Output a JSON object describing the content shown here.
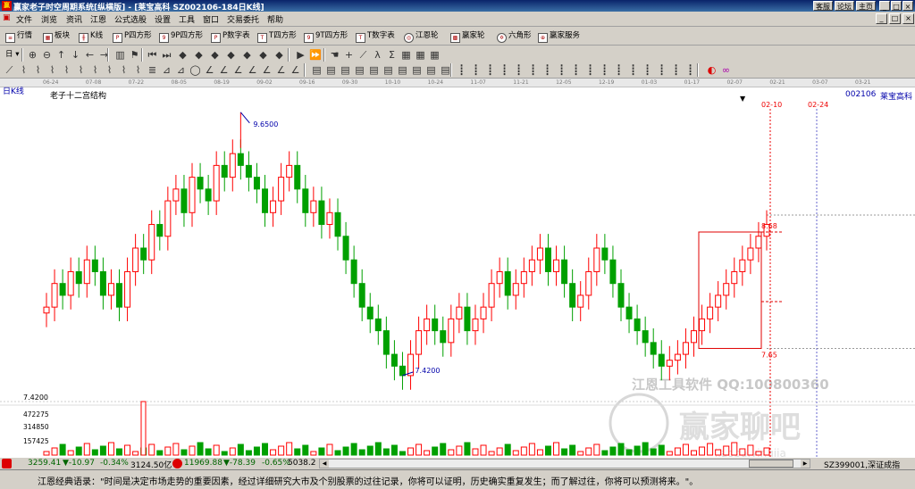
{
  "window": {
    "title": "赢家老子时空周期系统[纵横版] - [莱宝高科  SZ002106-184日K线]",
    "icon_text": "赢",
    "right_buttons": [
      "客服",
      "论坛",
      "主页"
    ],
    "controls": [
      "_",
      "□",
      "×"
    ]
  },
  "menu": {
    "items": [
      "文件",
      "浏览",
      "资讯",
      "江恩",
      "公式选股",
      "设置",
      "工具",
      "窗口",
      "交易委托",
      "帮助"
    ],
    "mdi_controls": [
      "_",
      "□",
      "×"
    ]
  },
  "toolbar1": {
    "items": [
      {
        "label": "行情",
        "icon": "quote-icon"
      },
      {
        "label": "板块",
        "icon": "sector-icon"
      },
      {
        "label": "K线",
        "icon": "kline-icon"
      },
      {
        "label": "P四方形",
        "icon": "p-square-icon"
      },
      {
        "label": "9P四方形",
        "icon": "9p-square-icon"
      },
      {
        "label": "P数字表",
        "icon": "p-table-icon"
      },
      {
        "label": "T四方形",
        "icon": "t-square-icon"
      },
      {
        "label": "9T四方形",
        "icon": "9t-square-icon"
      },
      {
        "label": "T数字表",
        "icon": "t-table-icon"
      },
      {
        "label": "江恩轮",
        "icon": "gann-wheel-icon"
      },
      {
        "label": "赢家轮",
        "icon": "winner-wheel-icon"
      },
      {
        "label": "六角形",
        "icon": "hexagon-icon"
      },
      {
        "label": "赢家服务",
        "icon": "service-icon"
      }
    ]
  },
  "toolbar2": {
    "period_label": "日"
  },
  "chart": {
    "period": "日K线",
    "name": "老子十二宫结构",
    "code": "002106",
    "stock": "莱宝高科",
    "date_ticks": [
      "06-24",
      "07-08",
      "07-22",
      "08-05",
      "08-19",
      "09-02",
      "09-16",
      "09-30",
      "10-10",
      "10-24",
      "11-07",
      "11-21",
      "12-05",
      "12-19",
      "01-03",
      "01-17",
      "02-07",
      "02-21",
      "03-07",
      "03-21"
    ],
    "high_label": "9.6500",
    "low_label": "7.4200",
    "low_axis_label": "7.4200",
    "box_top_label": "8.68",
    "box_bottom_label": "7.65",
    "vline1_label": "02-10",
    "vline2_label": "02-24",
    "watermark": "江恩工具软件  QQ:100800360",
    "watermark_logo": "赢家聊吧",
    "watermark_sub": "jiaoba.yingjia",
    "volume_axis": [
      "472275",
      "314850",
      "157425"
    ]
  },
  "chart_data": {
    "type": "candlestick",
    "title": "老子十二宫结构",
    "x_ticks": [
      "06-24",
      "07-08",
      "07-22",
      "08-05",
      "08-19",
      "09-02",
      "09-16",
      "09-30",
      "10-10",
      "10-24",
      "11-07",
      "11-21",
      "12-05",
      "12-19",
      "01-03",
      "01-17",
      "02-07",
      "02-21",
      "03-07",
      "03-21"
    ],
    "closes": [
      8.0,
      8.2,
      8.1,
      8.3,
      8.2,
      8.4,
      8.3,
      8.1,
      8.2,
      8.0,
      8.3,
      8.5,
      8.4,
      8.7,
      8.6,
      8.9,
      9.0,
      8.8,
      9.1,
      9.0,
      8.9,
      9.2,
      9.1,
      9.3,
      9.2,
      9.1,
      9.0,
      8.8,
      8.9,
      9.1,
      9.2,
      9.0,
      8.8,
      8.9,
      8.7,
      8.8,
      8.6,
      8.4,
      8.2,
      8.0,
      7.9,
      7.8,
      7.6,
      7.5,
      7.42,
      7.6,
      7.8,
      7.9,
      7.8,
      7.7,
      7.9,
      8.0,
      7.8,
      7.9,
      8.0,
      8.2,
      8.3,
      8.1,
      8.2,
      8.3,
      8.4,
      8.5,
      8.3,
      8.4,
      8.2,
      8.0,
      8.1,
      8.3,
      8.5,
      8.4,
      8.2,
      8.0,
      7.9,
      7.8,
      7.7,
      7.6,
      7.5,
      7.55,
      7.6,
      7.7,
      7.8,
      7.9,
      8.0,
      8.1,
      8.2,
      8.3,
      8.4,
      8.5,
      8.6,
      8.7
    ],
    "key_levels": {
      "high": 9.65,
      "low": 7.42,
      "box_top": 8.68,
      "box_bottom": 7.65
    },
    "volume_ticks": [
      157425,
      314850,
      472275
    ]
  },
  "status": {
    "sh_index": "3259.41",
    "sh_change": "▼-10.97",
    "sh_pct": "-0.34%",
    "sh_amount": "3124.50亿",
    "sz_index": "11969.88",
    "sz_change": "▼-78.39",
    "sz_pct": "-0.65%",
    "sz_amount": "5038.2",
    "sz_code": "SZ399001,深证成指"
  },
  "quote": "江恩经典语录：\"时间是决定市场走势的重要因素，经过详细研究大市及个别股票的过往记录，你将可以证明，历史确实重复发生；而了解过往，你将可以预测将来。\"。",
  "colors": {
    "up": "#ff0000",
    "down": "#00a000",
    "box": "#e00000",
    "bg": "#ffffff",
    "chrome": "#d4d0c8"
  }
}
